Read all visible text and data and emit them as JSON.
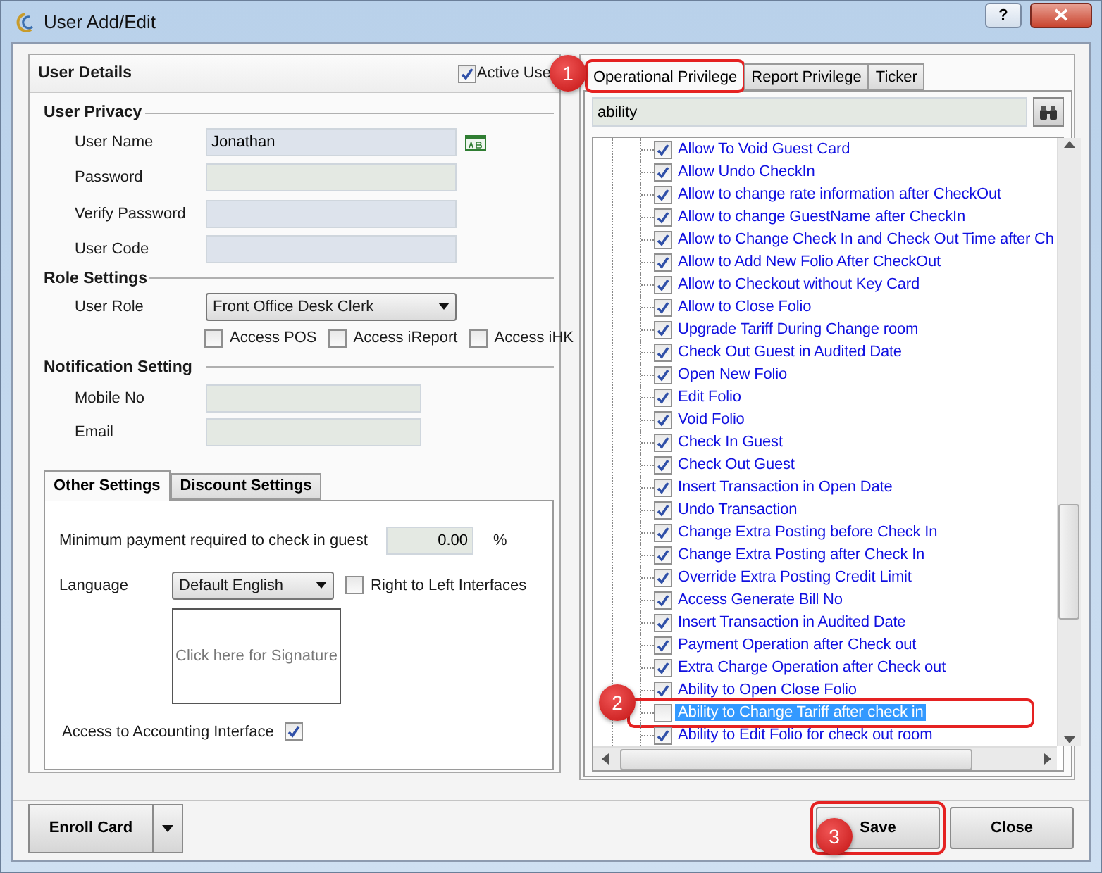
{
  "window": {
    "title": "User Add/Edit",
    "help_button": "?"
  },
  "user_details": {
    "title": "User Details",
    "active_user": {
      "label": "Active Use",
      "checked": true
    }
  },
  "user_privacy": {
    "title": "User Privacy",
    "fields": [
      {
        "label": "User Name",
        "value": "Jonathan",
        "kind": "keyboard"
      },
      {
        "label": "Password",
        "kind": "text"
      },
      {
        "label": "Verify Password",
        "kind": "text"
      },
      {
        "label": "User Code",
        "kind": "text"
      }
    ]
  },
  "role_settings": {
    "title": "Role Settings",
    "user_role": {
      "label": "User Role",
      "value": "Front Office Desk Clerk"
    },
    "access": [
      {
        "label": "Access POS",
        "checked": false
      },
      {
        "label": "Access iReport",
        "checked": false
      },
      {
        "label": "Access iHK",
        "checked": false
      }
    ]
  },
  "notification_setting": {
    "title": "Notification Setting",
    "fields": [
      {
        "label": "Mobile No"
      },
      {
        "label": "Email"
      }
    ]
  },
  "settings_tabs": [
    {
      "label": "Other Settings",
      "selected": true
    },
    {
      "label": "Discount Settings",
      "selected": false
    }
  ],
  "other_settings": {
    "minimum_payment": {
      "label": "Minimum payment required to check in guest",
      "value": "0.00",
      "unit": "%"
    },
    "language": {
      "label": "Language",
      "value": "Default English"
    },
    "right_to_left": {
      "label": "Right to Left Interfaces",
      "checked": false
    },
    "signature": {
      "placeholder": "Click here for Signature"
    },
    "accounting": {
      "label": "Access to Accounting Interface",
      "checked": true
    }
  },
  "privilege_tabs": [
    {
      "label": "Operational Privilege",
      "selected": true,
      "callout": "1"
    },
    {
      "label": "Report Privilege",
      "selected": false
    },
    {
      "label": "Ticker",
      "selected": false
    }
  ],
  "search": {
    "value": "ability"
  },
  "privileges": [
    {
      "label": "Allow To Void Guest Card",
      "checked": true,
      "selected": false
    },
    {
      "label": "Allow Undo CheckIn",
      "checked": true,
      "selected": false
    },
    {
      "label": "Allow to change rate information after CheckOut",
      "checked": true,
      "selected": false
    },
    {
      "label": "Allow to change GuestName after CheckIn",
      "checked": true,
      "selected": false
    },
    {
      "label": "Allow to Change Check In and Check Out Time after Ch",
      "checked": true,
      "selected": false
    },
    {
      "label": "Allow to Add New Folio After CheckOut",
      "checked": true,
      "selected": false
    },
    {
      "label": "Allow to Checkout without Key Card",
      "checked": true,
      "selected": false
    },
    {
      "label": "Allow to Close Folio",
      "checked": true,
      "selected": false
    },
    {
      "label": "Upgrade Tariff During Change room",
      "checked": true,
      "selected": false
    },
    {
      "label": "Check Out Guest in Audited Date",
      "checked": true,
      "selected": false
    },
    {
      "label": "Open New Folio",
      "checked": true,
      "selected": false
    },
    {
      "label": "Edit Folio",
      "checked": true,
      "selected": false
    },
    {
      "label": "Void Folio",
      "checked": true,
      "selected": false
    },
    {
      "label": "Check In Guest",
      "checked": true,
      "selected": false
    },
    {
      "label": "Check Out Guest",
      "checked": true,
      "selected": false
    },
    {
      "label": "Insert Transaction in Open Date",
      "checked": true,
      "selected": false
    },
    {
      "label": "Undo Transaction",
      "checked": true,
      "selected": false
    },
    {
      "label": "Change Extra Posting before Check In",
      "checked": true,
      "selected": false
    },
    {
      "label": "Change Extra Posting after Check In",
      "checked": true,
      "selected": false
    },
    {
      "label": "Override Extra Posting Credit Limit",
      "checked": true,
      "selected": false
    },
    {
      "label": "Access Generate Bill No",
      "checked": true,
      "selected": false
    },
    {
      "label": "Insert Transaction in Audited Date",
      "checked": true,
      "selected": false
    },
    {
      "label": "Payment Operation after Check out",
      "checked": true,
      "selected": false
    },
    {
      "label": "Extra Charge Operation after Check out",
      "checked": true,
      "selected": false
    },
    {
      "label": "Ability to Open Close Folio",
      "checked": true,
      "selected": false
    },
    {
      "label": "Ability to Change Tariff after check in",
      "checked": false,
      "selected": true,
      "callout": "2"
    },
    {
      "label": "Ability to Edit Folio for check out room",
      "checked": true,
      "selected": false
    }
  ],
  "footer": {
    "enroll_button": "Enroll Card",
    "buttons": [
      {
        "label": "Save",
        "callout": "3"
      },
      {
        "label": "Close"
      }
    ]
  }
}
